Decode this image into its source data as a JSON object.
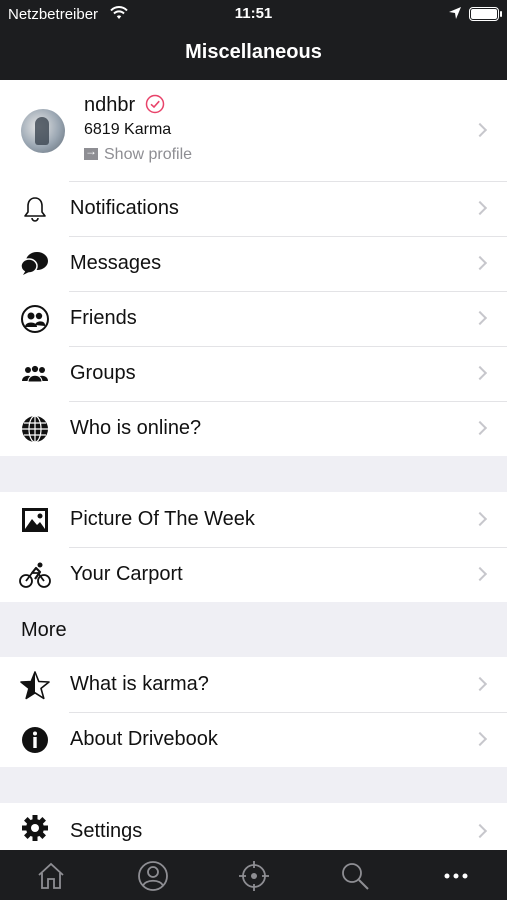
{
  "status_bar": {
    "carrier": "Netzbetreiber",
    "time": "11:51"
  },
  "nav": {
    "title": "Miscellaneous"
  },
  "profile": {
    "username": "ndhbr",
    "karma": "6819 Karma",
    "show_profile": "Show profile",
    "verified_color": "#e8436a"
  },
  "menu_section_1": [
    {
      "label": "Notifications",
      "icon": "bell-icon"
    },
    {
      "label": "Messages",
      "icon": "chat-bubble-icon"
    },
    {
      "label": "Friends",
      "icon": "friends-icon"
    },
    {
      "label": "Groups",
      "icon": "groups-icon"
    },
    {
      "label": "Who is online?",
      "icon": "globe-icon"
    }
  ],
  "menu_section_2": [
    {
      "label": "Picture Of The Week",
      "icon": "picture-icon"
    },
    {
      "label": "Your Carport",
      "icon": "cyclist-icon"
    }
  ],
  "more_header": "More",
  "menu_section_3": [
    {
      "label": "What is karma?",
      "icon": "star-icon"
    },
    {
      "label": "About Drivebook",
      "icon": "info-icon"
    }
  ],
  "menu_section_4": [
    {
      "label": "Settings",
      "icon": "gear-icon"
    }
  ],
  "tab_bar": [
    {
      "name": "home-icon"
    },
    {
      "name": "profile-icon"
    },
    {
      "name": "crosshair-icon"
    },
    {
      "name": "search-icon"
    },
    {
      "name": "more-icon"
    }
  ],
  "colors": {
    "bars": "#1c1d1f",
    "background": "#efeff4",
    "chevron": "#c7c7cc"
  }
}
